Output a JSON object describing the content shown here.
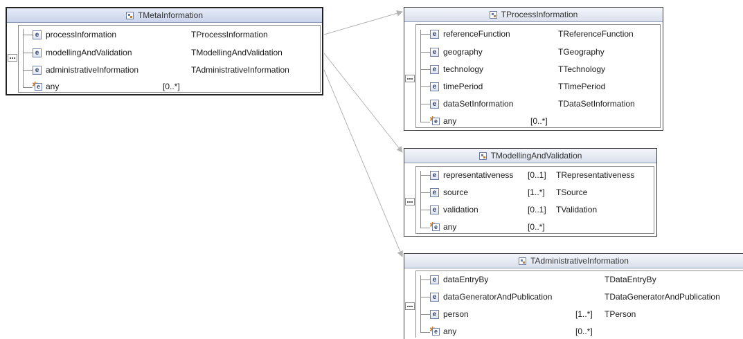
{
  "boxes": {
    "meta": {
      "title": "TMetaInformation",
      "rows": [
        {
          "name": "processInformation",
          "card": "",
          "type": "TProcessInformation"
        },
        {
          "name": "modellingAndValidation",
          "card": "",
          "type": "TModellingAndValidation"
        },
        {
          "name": "administrativeInformation",
          "card": "",
          "type": "TAdministrativeInformation"
        }
      ],
      "any": {
        "name": "any",
        "card": "[0..*]"
      }
    },
    "process": {
      "title": "TProcessInformation",
      "rows": [
        {
          "name": "referenceFunction",
          "card": "",
          "type": "TReferenceFunction"
        },
        {
          "name": "geography",
          "card": "",
          "type": "TGeography"
        },
        {
          "name": "technology",
          "card": "",
          "type": "TTechnology"
        },
        {
          "name": "timePeriod",
          "card": "",
          "type": "TTimePeriod"
        },
        {
          "name": "dataSetInformation",
          "card": "",
          "type": "TDataSetInformation"
        }
      ],
      "any": {
        "name": "any",
        "card": "[0..*]"
      }
    },
    "modelling": {
      "title": "TModellingAndValidation",
      "rows": [
        {
          "name": "representativeness",
          "card": "[0..1]",
          "type": "TRepresentativeness"
        },
        {
          "name": "source",
          "card": "[1..*]",
          "type": "TSource"
        },
        {
          "name": "validation",
          "card": "[0..1]",
          "type": "TValidation"
        }
      ],
      "any": {
        "name": "any",
        "card": "[0..*]"
      }
    },
    "admin": {
      "title": "TAdministrativeInformation",
      "rows": [
        {
          "name": "dataEntryBy",
          "card": "",
          "type": "TDataEntryBy"
        },
        {
          "name": "dataGeneratorAndPublication",
          "card": "",
          "type": "TDataGeneratorAndPublication"
        },
        {
          "name": "person",
          "card": "[1..*]",
          "type": "TPerson"
        }
      ],
      "any": {
        "name": "any",
        "card": "[0..*]"
      }
    }
  },
  "icons": {
    "type_icon": "complex-type-icon",
    "element_icon": "element-icon",
    "element_glyph": "e",
    "any_icon": "any-element-icon",
    "compositor_icon": "sequence-compositor-icon"
  },
  "colors": {
    "connector": "#b4b4b4",
    "header_gradient_top": "#f4f6fb",
    "header_gradient_bottom": "#d9dfec",
    "border": "#3c3c3c"
  }
}
